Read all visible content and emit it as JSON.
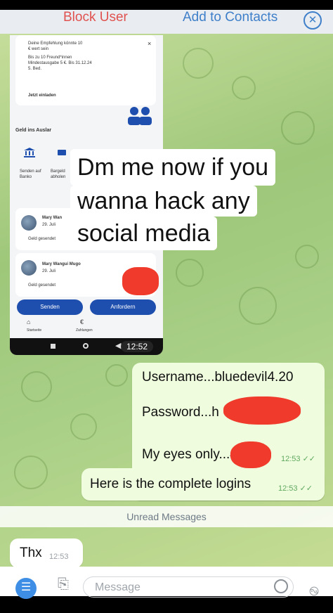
{
  "header": {
    "block_user": "Block User",
    "add_to_contacts": "Add to Contacts",
    "close_glyph": "✕"
  },
  "screenshot": {
    "promo_lines": [
      "Deine Empfehlung könnte 10",
      "€ wert sein",
      "Bis zu 10 Freund*innen",
      "Mindestausgabe 5 €. Bis 31.12.24",
      "5. Bed."
    ],
    "invite_label": "Jetzt einladen",
    "dismiss": "×",
    "section_title": "Geld ins Auslar",
    "action_1": "Senden auf Banko",
    "action_2": "Bargeld abholen",
    "tx1_name": "Mary Wan",
    "tx1_date": "29. Juli",
    "tx1_status": "Geld gesendet",
    "tx2_name": "Mary Wangui Mugo",
    "tx2_date": "29. Juli",
    "tx2_status": "Geld gesendet",
    "send_button": "Senden",
    "request_button": "Anfordern",
    "tab_home": "Startseite",
    "tab_payments": "Zahlungen",
    "time": "12:52"
  },
  "caption": {
    "line1": "Dm me now if you",
    "line2": "wanna hack any",
    "line3": "social media"
  },
  "messages": {
    "logins": {
      "username": "Username...bluedevil4.20",
      "password": "Password...h",
      "eyes_only": "My eyes only...4",
      "time": "12:53 ✓✓"
    },
    "complete": {
      "text": "Here is the complete logins",
      "time": "12:53 ✓✓"
    },
    "unread_divider": "Unread Messages",
    "thx": {
      "text": "Thx",
      "time": "12:53"
    }
  },
  "input": {
    "placeholder": "Message",
    "menu_glyph": "☰",
    "attach_glyph": "⎘",
    "mic_glyph": "࿊"
  }
}
